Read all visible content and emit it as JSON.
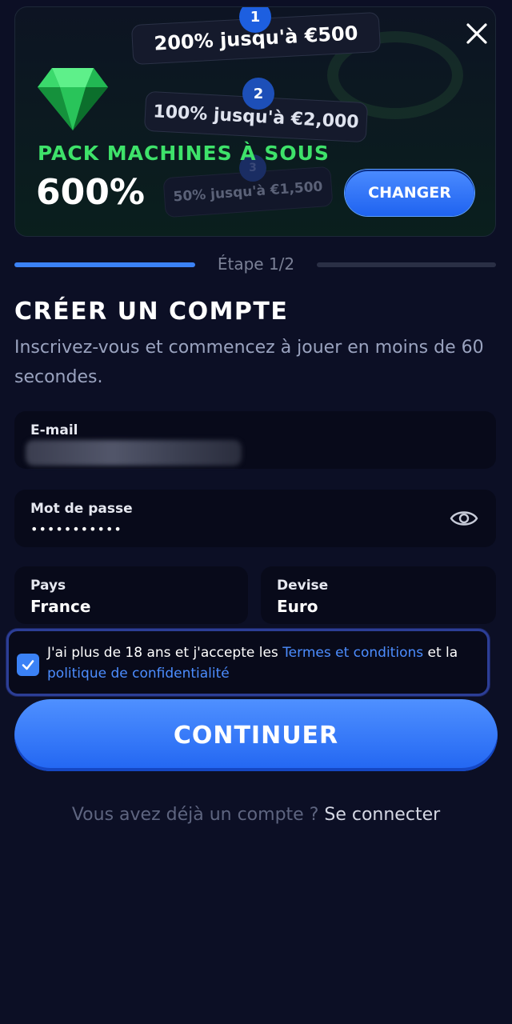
{
  "banner": {
    "tiers": [
      {
        "number": "1",
        "text": "200% jusqu'à €500"
      },
      {
        "number": "2",
        "text": "100% jusqu'à €2,000"
      },
      {
        "number": "3",
        "text": "50% jusqu'à €1,500"
      }
    ],
    "pack_title": "PACK MACHINES À SOUS",
    "pack_percent": "600%",
    "change_label": "CHANGER"
  },
  "steps": {
    "label": "Étape 1/2",
    "current": 1,
    "total": 2
  },
  "header": {
    "title": "CRÉER UN COMPTE",
    "subtitle": "Inscrivez-vous et commencez à jouer en moins de 60 secondes."
  },
  "form": {
    "email_label": "E-mail",
    "password_label": "Mot de passe",
    "password_mask": "•••••••••••",
    "country_label": "Pays",
    "country_value": "France",
    "currency_label": "Devise",
    "currency_value": "Euro"
  },
  "consent": {
    "checked": true,
    "text_before": "J'ai plus de 18 ans et j'accepte les ",
    "terms_link": "Termes et conditions",
    "text_middle": " et la ",
    "privacy_link": "politique de confidentialité"
  },
  "continue_label": "CONTINUER",
  "signin": {
    "prompt": "Vous avez déjà un compte ? ",
    "link": "Se connecter"
  },
  "colors": {
    "background": "#0c0f25",
    "accent": "#3b82f6",
    "pack_green": "#3ee26a"
  }
}
